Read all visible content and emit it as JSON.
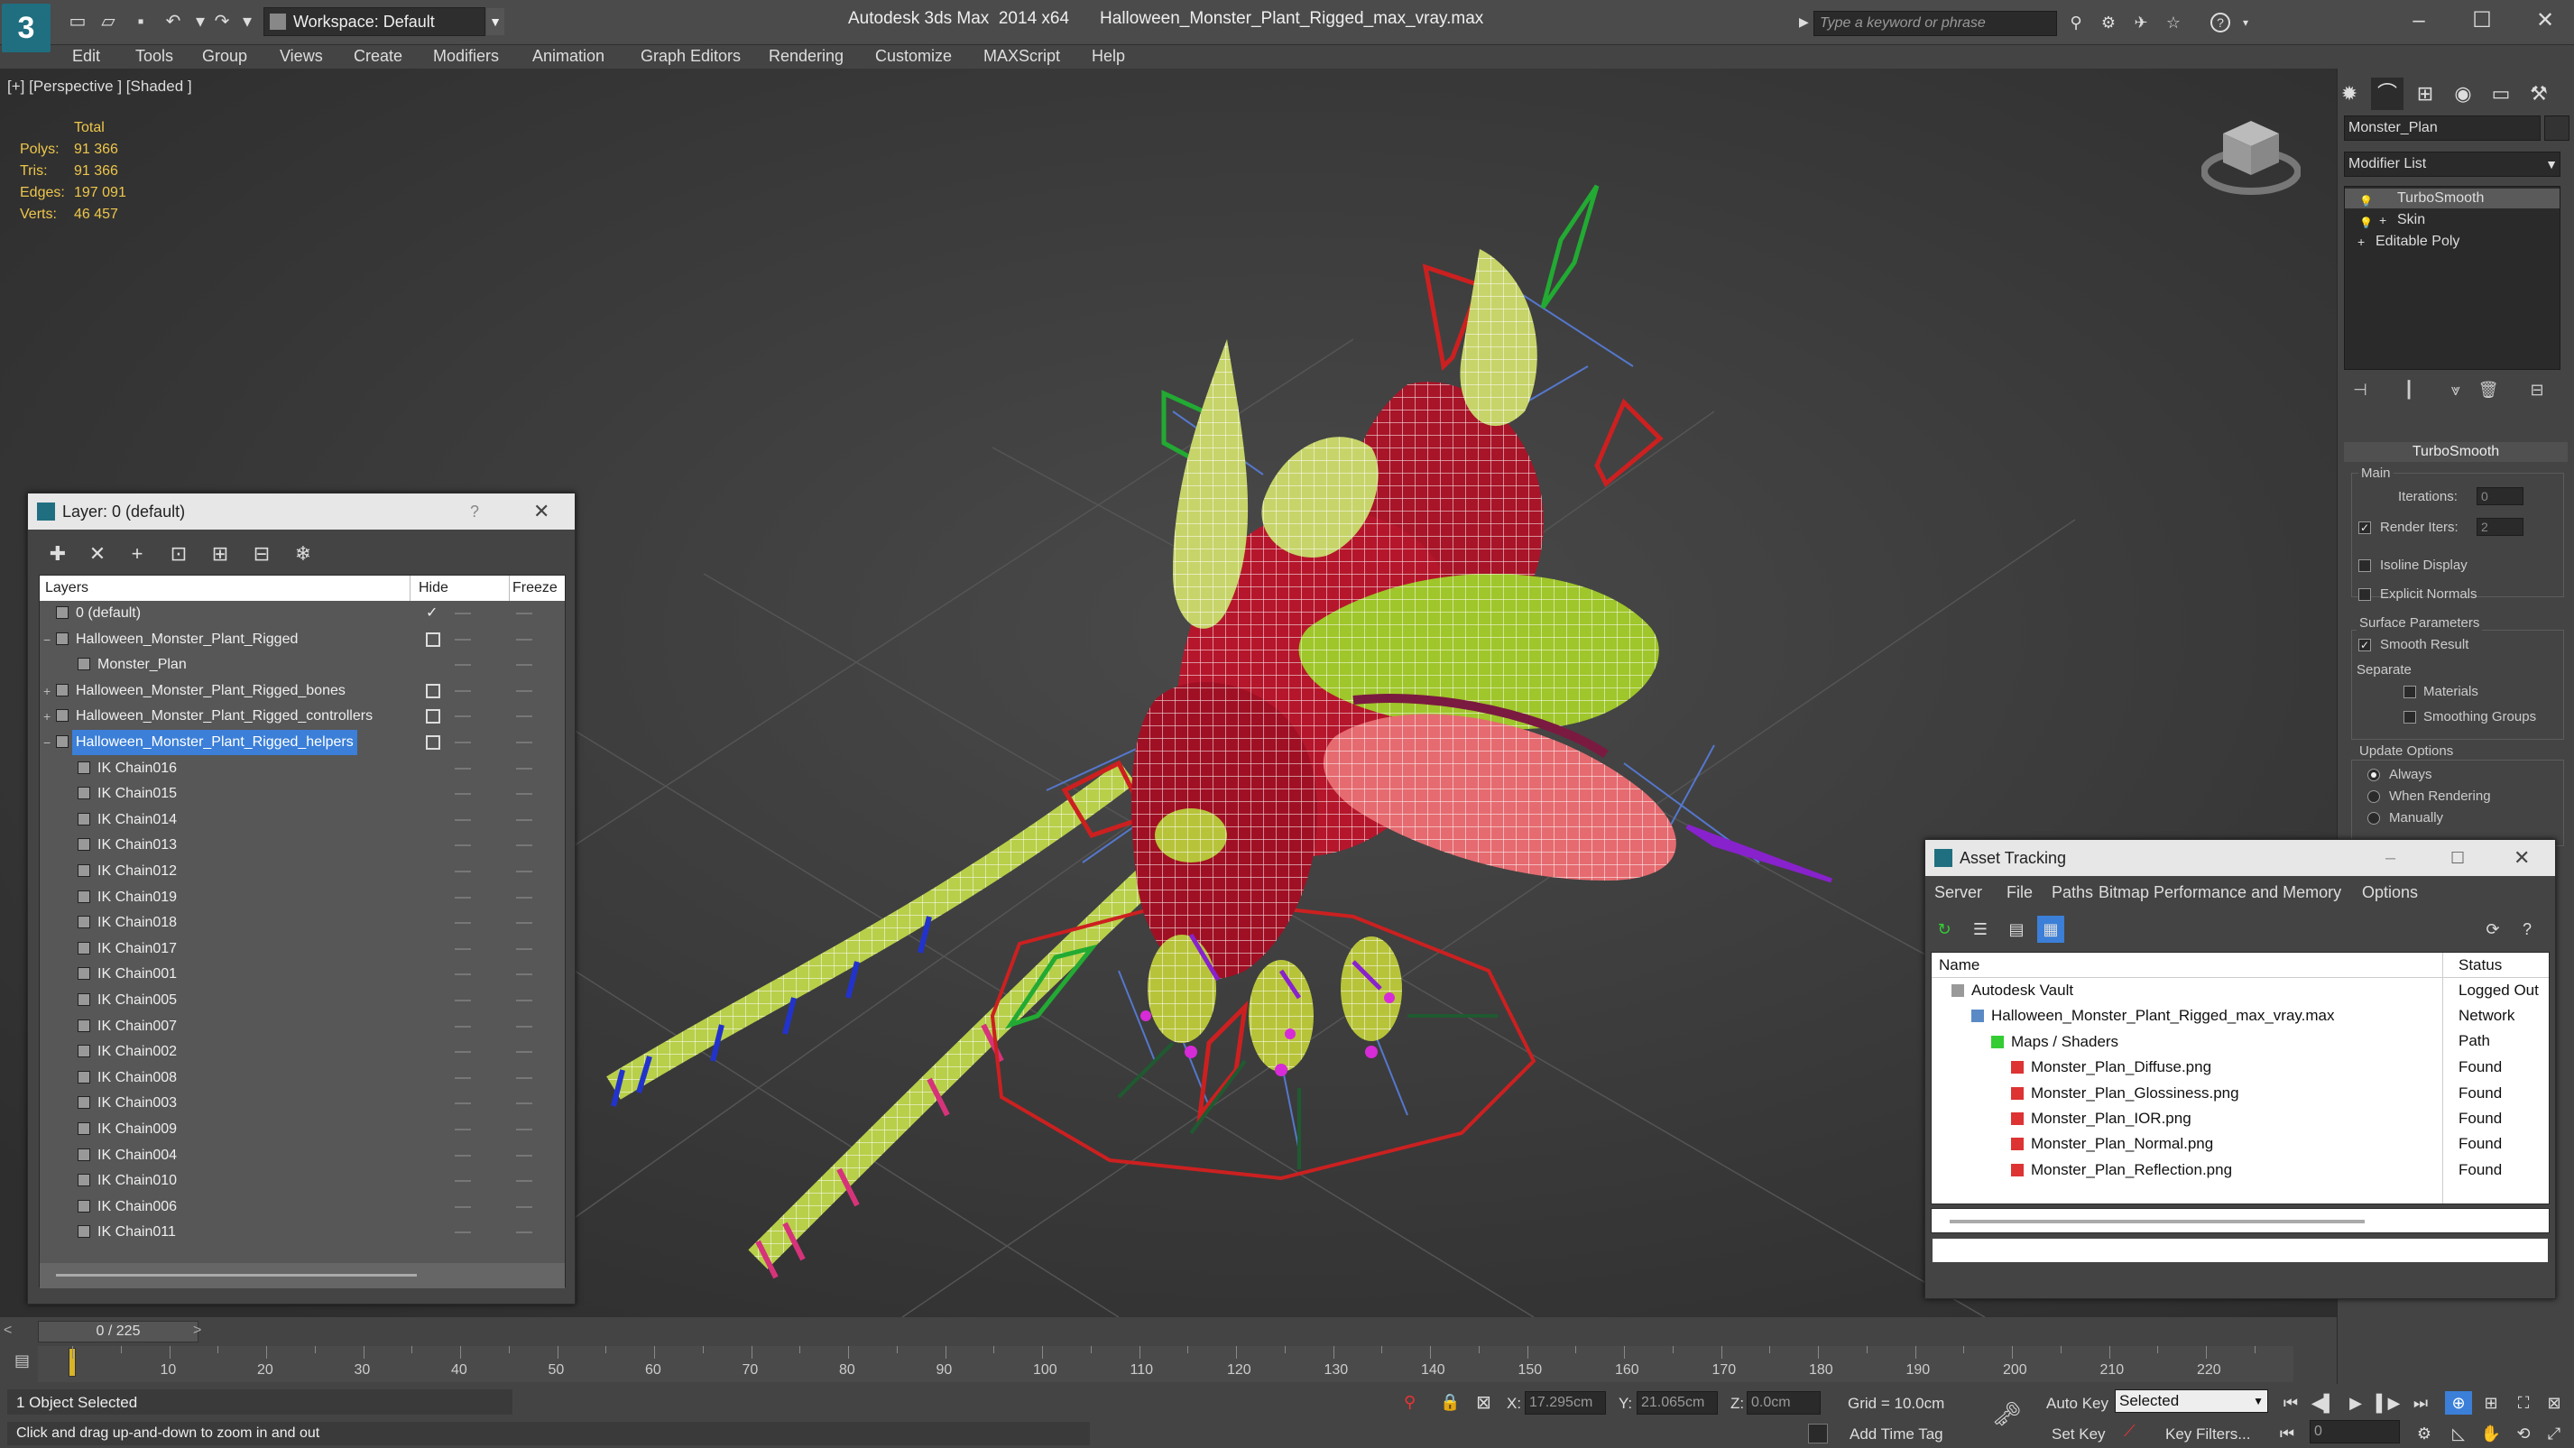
{
  "titlebar": {
    "workspace": "Workspace: Default",
    "app_title": "Autodesk 3ds Max  2014 x64",
    "file_title": "Halloween_Monster_Plant_Rigged_max_vray.max",
    "search_placeholder": "Type a keyword or phrase"
  },
  "menu": [
    "Edit",
    "Tools",
    "Group",
    "Views",
    "Create",
    "Modifiers",
    "Animation",
    "Graph Editors",
    "Rendering",
    "Customize",
    "MAXScript",
    "Help"
  ],
  "viewport": {
    "label": "[+] [Perspective ] [Shaded ]",
    "stats": {
      "header": "Total",
      "polys_label": "Polys:",
      "polys": "91 366",
      "tris_label": "Tris:",
      "tris": "91 366",
      "edges_label": "Edges:",
      "edges": "197 091",
      "verts_label": "Verts:",
      "verts": "46 457"
    }
  },
  "layer_dialog": {
    "title": "Layer: 0 (default)",
    "help": "?",
    "headers": {
      "layers": "Layers",
      "hide": "Hide",
      "freeze": "Freeze"
    },
    "rows": [
      {
        "name": "0 (default)",
        "level": 0,
        "expand": "",
        "checked": true
      },
      {
        "name": "Halloween_Monster_Plant_Rigged",
        "level": 0,
        "expand": "−",
        "hide_box": true
      },
      {
        "name": "Monster_Plan",
        "level": 1,
        "expand": ""
      },
      {
        "name": "Halloween_Monster_Plant_Rigged_bones",
        "level": 0,
        "expand": "+",
        "hide_box": true
      },
      {
        "name": "Halloween_Monster_Plant_Rigged_controllers",
        "level": 0,
        "expand": "+",
        "hide_box": true
      },
      {
        "name": "Halloween_Monster_Plant_Rigged_helpers",
        "level": 0,
        "expand": "−",
        "hide_box": true,
        "selected": true
      },
      {
        "name": "IK Chain016",
        "level": 1
      },
      {
        "name": "IK Chain015",
        "level": 1
      },
      {
        "name": "IK Chain014",
        "level": 1
      },
      {
        "name": "IK Chain013",
        "level": 1
      },
      {
        "name": "IK Chain012",
        "level": 1
      },
      {
        "name": "IK Chain019",
        "level": 1
      },
      {
        "name": "IK Chain018",
        "level": 1
      },
      {
        "name": "IK Chain017",
        "level": 1
      },
      {
        "name": "IK Chain001",
        "level": 1
      },
      {
        "name": "IK Chain005",
        "level": 1
      },
      {
        "name": "IK Chain007",
        "level": 1
      },
      {
        "name": "IK Chain002",
        "level": 1
      },
      {
        "name": "IK Chain008",
        "level": 1
      },
      {
        "name": "IK Chain003",
        "level": 1
      },
      {
        "name": "IK Chain009",
        "level": 1
      },
      {
        "name": "IK Chain004",
        "level": 1
      },
      {
        "name": "IK Chain010",
        "level": 1
      },
      {
        "name": "IK Chain006",
        "level": 1
      },
      {
        "name": "IK Chain011",
        "level": 1
      }
    ]
  },
  "command_panel": {
    "object_name": "Monster_Plan",
    "modifier_list": "Modifier List",
    "stack": [
      "TurboSmooth",
      "Skin",
      "Editable Poly"
    ],
    "rollout": "TurboSmooth",
    "main_label": "Main",
    "iterations_label": "Iterations:",
    "iterations": "0",
    "render_iters_label": "Render Iters:",
    "render_iters": "2",
    "isoline_label": "Isoline Display",
    "explicit_label": "Explicit Normals",
    "surface_label": "Surface Parameters",
    "smooth_label": "Smooth Result",
    "separate_label": "Separate",
    "materials_label": "Materials",
    "smoothing_label": "Smoothing Groups",
    "update_label": "Update Options",
    "always_label": "Always",
    "when_rendering_label": "When Rendering",
    "manually_label": "Manually"
  },
  "asset_tracking": {
    "title": "Asset Tracking",
    "menu": [
      "Server",
      "File",
      "Paths",
      "Bitmap Performance and Memory",
      "Options"
    ],
    "headers": {
      "name": "Name",
      "status": "Status"
    },
    "rows": [
      {
        "name": "Autodesk Vault",
        "status": "Logged Out",
        "level": 0,
        "icon": "vault"
      },
      {
        "name": "Halloween_Monster_Plant_Rigged_max_vray.max",
        "status": "Network Path",
        "level": 1,
        "icon": "max"
      },
      {
        "name": "Maps / Shaders",
        "status": "",
        "level": 2,
        "icon": "maps"
      },
      {
        "name": "Monster_Plan_Diffuse.png",
        "status": "Found",
        "level": 3,
        "icon": "png"
      },
      {
        "name": "Monster_Plan_Glossiness.png",
        "status": "Found",
        "level": 3,
        "icon": "png"
      },
      {
        "name": "Monster_Plan_IOR.png",
        "status": "Found",
        "level": 3,
        "icon": "png"
      },
      {
        "name": "Monster_Plan_Normal.png",
        "status": "Found",
        "level": 3,
        "icon": "png"
      },
      {
        "name": "Monster_Plan_Reflection.png",
        "status": "Found",
        "level": 3,
        "icon": "png"
      }
    ]
  },
  "timeline": {
    "frame": "0 / 225",
    "ticks": [
      "10",
      "20",
      "30",
      "40",
      "50",
      "60",
      "70",
      "80",
      "90",
      "100",
      "110",
      "120",
      "130",
      "140",
      "150",
      "160",
      "170",
      "180",
      "190",
      "200",
      "210",
      "220"
    ]
  },
  "status": {
    "selected": "1 Object Selected",
    "hint": "Click and drag up-and-down to zoom in and out",
    "x_label": "X:",
    "x": "17.295cm",
    "y_label": "Y:",
    "y": "21.065cm",
    "z_label": "Z:",
    "z": "0.0cm",
    "grid": "Grid = 10.0cm",
    "add_time_tag": "Add Time Tag",
    "auto_key": "Auto Key",
    "set_key": "Set Key",
    "selected_option": "Selected",
    "key_filters": "Key Filters...",
    "frame_value": "0"
  },
  "colors": {
    "accent": "#3b7fd8",
    "stats": "#eec64b",
    "plant_red": "#b5162b",
    "plant_green": "#9fc62a",
    "rig_red": "#d42020",
    "rig_green": "#22aa33"
  }
}
